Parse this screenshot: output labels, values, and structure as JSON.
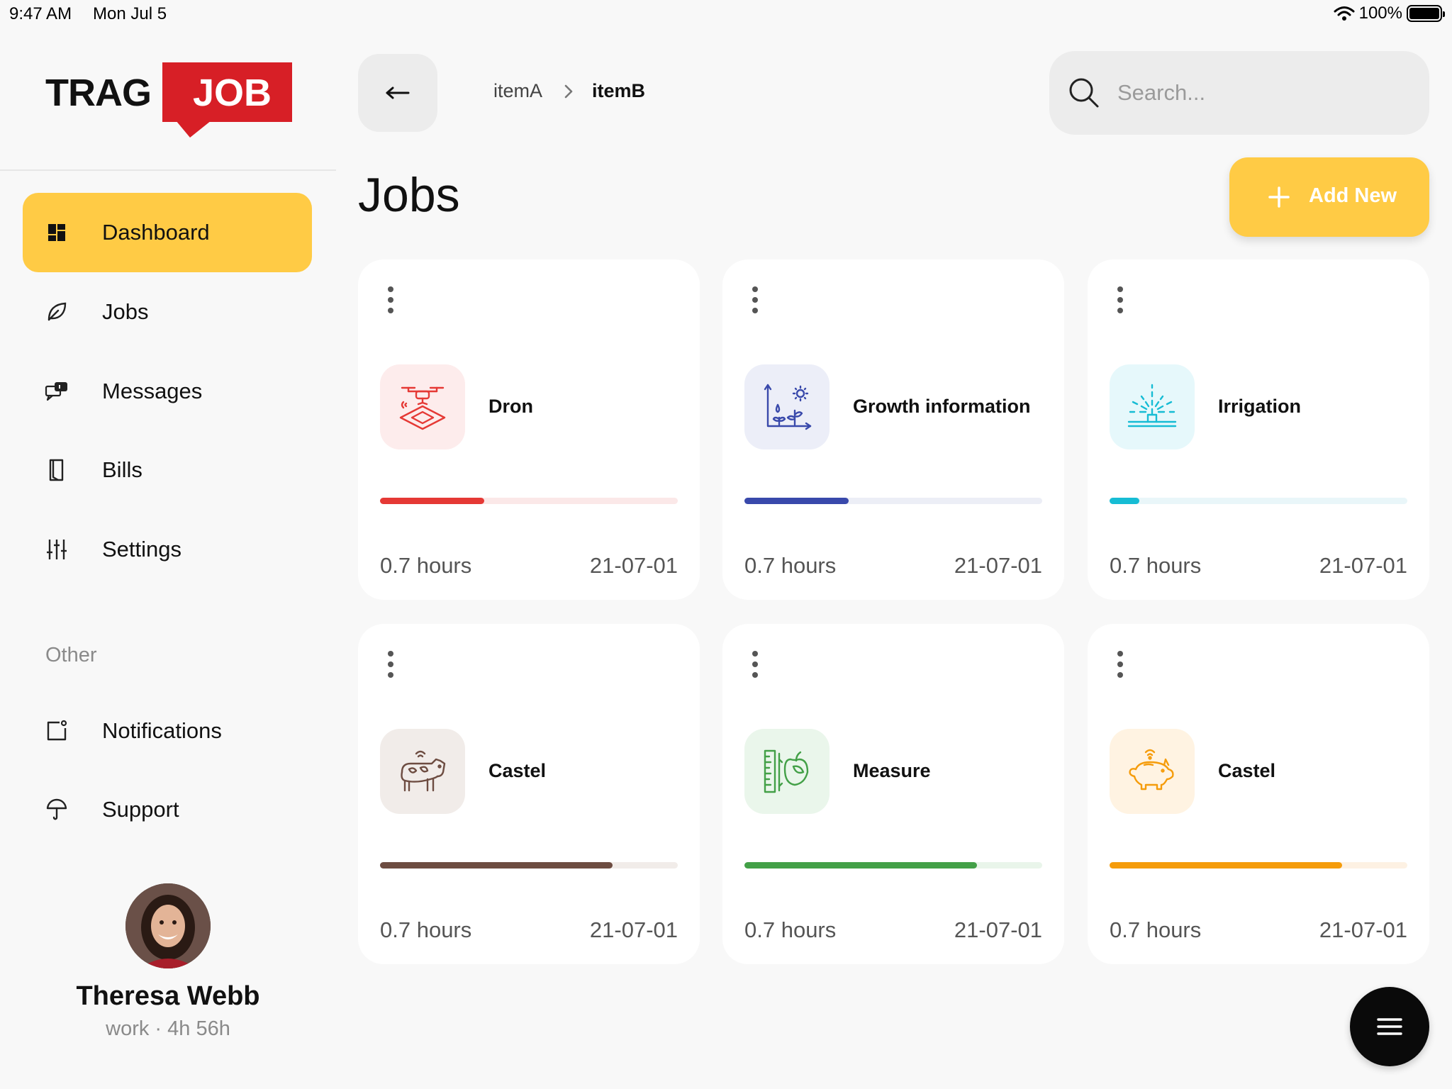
{
  "status_bar": {
    "time": "9:47 AM",
    "date": "Mon Jul 5",
    "battery": "100%"
  },
  "brand": {
    "part1": "TRAG",
    "part2": "JOB",
    "accent_color": "#d71f26"
  },
  "sidebar": {
    "items": [
      {
        "label": "Dashboard",
        "icon": "dashboard-icon",
        "active": true
      },
      {
        "label": "Jobs",
        "icon": "leaf-icon",
        "active": false
      },
      {
        "label": "Messages",
        "icon": "messages-icon",
        "active": false
      },
      {
        "label": "Bills",
        "icon": "bill-icon",
        "active": false
      },
      {
        "label": "Settings",
        "icon": "sliders-icon",
        "active": false
      }
    ],
    "other_label": "Other",
    "other_items": [
      {
        "label": "Notifications",
        "icon": "notification-icon"
      },
      {
        "label": "Support",
        "icon": "umbrella-icon"
      }
    ]
  },
  "profile": {
    "name": "Theresa Webb",
    "subtitle": "work · 4h 56h"
  },
  "breadcrumb": {
    "item_a": "itemA",
    "item_b": "itemB"
  },
  "search": {
    "placeholder": "Search..."
  },
  "page": {
    "title": "Jobs",
    "add_label": "Add New",
    "accent_color": "#ffcb45"
  },
  "cards": [
    {
      "title": "Dron",
      "hours": "0.7 hours",
      "date": "21-07-01",
      "progress": 0.35,
      "color": "#e53935",
      "bg": "#fdecec",
      "track": "#fbe8e8",
      "icon": "drone-icon"
    },
    {
      "title": "Growth information",
      "hours": "0.7 hours",
      "date": "21-07-01",
      "progress": 0.35,
      "color": "#3949ab",
      "bg": "#eceef8",
      "track": "#eceef6",
      "icon": "growth-chart-icon"
    },
    {
      "title": "Irrigation",
      "hours": "0.7 hours",
      "date": "21-07-01",
      "progress": 0.1,
      "color": "#16bcd4",
      "bg": "#e6f8fb",
      "track": "#e9f6f9",
      "icon": "sprinkler-icon"
    },
    {
      "title": "Castel",
      "hours": "0.7 hours",
      "date": "21-07-01",
      "progress": 0.78,
      "color": "#6d4c41",
      "bg": "#f1ece9",
      "track": "#f1ece9",
      "icon": "cow-icon"
    },
    {
      "title": "Measure",
      "hours": "0.7 hours",
      "date": "21-07-01",
      "progress": 0.78,
      "color": "#43a047",
      "bg": "#eaf6eb",
      "track": "#e9f5ea",
      "icon": "measure-apple-icon"
    },
    {
      "title": "Castel",
      "hours": "0.7 hours",
      "date": "21-07-01",
      "progress": 0.78,
      "color": "#f59c0b",
      "bg": "#fff3e2",
      "track": "#fdf1e3",
      "icon": "pig-icon"
    }
  ]
}
